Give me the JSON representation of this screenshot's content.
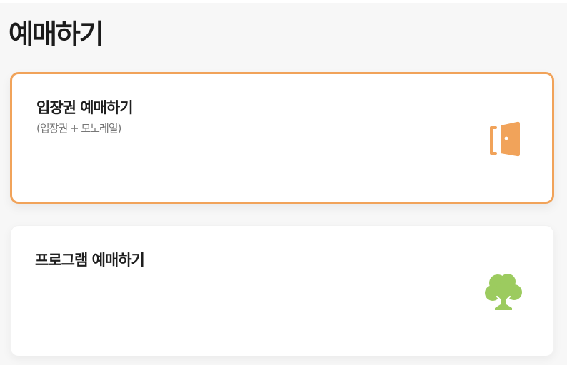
{
  "page": {
    "title": "예매하기"
  },
  "cards": [
    {
      "title": "입장권 예매하기",
      "subtitle": "(입장권 + 모노레일)",
      "icon": "door-icon",
      "accent_color": "#f1a35a",
      "selected": true
    },
    {
      "title": "프로그램 예매하기",
      "icon": "tree-icon",
      "accent_color": "#9ccb5f",
      "selected": false
    }
  ]
}
